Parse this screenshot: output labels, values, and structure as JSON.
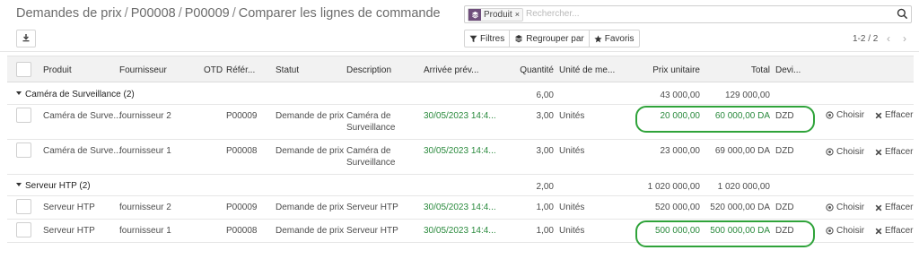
{
  "breadcrumb": {
    "items": [
      "Demandes de prix",
      "P00008",
      "P00009",
      "Comparer les lignes de commande"
    ]
  },
  "search": {
    "facet_label": "Produit",
    "facet_remove": "×",
    "placeholder": "Rechercher...",
    "icon": "search-icon"
  },
  "toolbar": {
    "download_icon": "download-icon",
    "filters_label": "Filtres",
    "group_label": "Regrouper par",
    "favorites_label": "Favoris"
  },
  "pager": {
    "range": "1-2 / 2",
    "prev": "‹",
    "next": "›"
  },
  "columns": {
    "produit": "Produit",
    "fournisseur": "Fournisseur",
    "otd": "OTD",
    "reference": "Référ...",
    "statut": "Statut",
    "description": "Description",
    "arrivee": "Arrivée prév...",
    "quantite": "Quantité",
    "unite": "Unité de me...",
    "prix": "Prix unitaire",
    "total": "Total",
    "devise": "Devi..."
  },
  "groups": [
    {
      "name": "Caméra de Surveillance (2)",
      "quantite": "6,00",
      "prix": "43 000,00",
      "total": "129 000,00",
      "rows": [
        {
          "produit": "Caméra de Surve...",
          "fournisseur": "fournisseur 2",
          "reference": "P00009",
          "statut": "Demande de prix",
          "description": "Caméra de Surveillance",
          "arrivee": "30/05/2023 14:4...",
          "quantite": "3,00",
          "unite": "Unités",
          "prix": "20 000,00",
          "total": "60 000,00 DA",
          "devise": "DZD",
          "choose": "Choisir",
          "clear": "Effacer"
        },
        {
          "produit": "Caméra de Surve...",
          "fournisseur": "fournisseur 1",
          "reference": "P00008",
          "statut": "Demande de prix",
          "description": "Caméra de Surveillance",
          "arrivee": "30/05/2023 14:4...",
          "quantite": "3,00",
          "unite": "Unités",
          "prix": "23 000,00",
          "total": "69 000,00 DA",
          "devise": "DZD",
          "choose": "Choisir",
          "clear": "Effacer"
        }
      ]
    },
    {
      "name": "Serveur HTP (2)",
      "quantite": "2,00",
      "prix": "1 020 000,00",
      "total": "1 020 000,00",
      "rows": [
        {
          "produit": "Serveur HTP",
          "fournisseur": "fournisseur 2",
          "reference": "P00009",
          "statut": "Demande de prix",
          "description": "Serveur HTP",
          "arrivee": "30/05/2023 14:4...",
          "quantite": "1,00",
          "unite": "Unités",
          "prix": "520 000,00",
          "total": "520 000,00 DA",
          "devise": "DZD",
          "choose": "Choisir",
          "clear": "Effacer"
        },
        {
          "produit": "Serveur HTP",
          "fournisseur": "fournisseur 1",
          "reference": "P00008",
          "statut": "Demande de prix",
          "description": "Serveur HTP",
          "arrivee": "30/05/2023 14:4...",
          "quantite": "1,00",
          "unite": "Unités",
          "prix": "500 000,00",
          "total": "500 000,00 DA",
          "devise": "DZD",
          "choose": "Choisir",
          "clear": "Effacer"
        }
      ]
    }
  ],
  "colors": {
    "brand": "#6f4e7c",
    "date_green": "#2a8a3d",
    "highlight_green": "#2fa33a"
  }
}
